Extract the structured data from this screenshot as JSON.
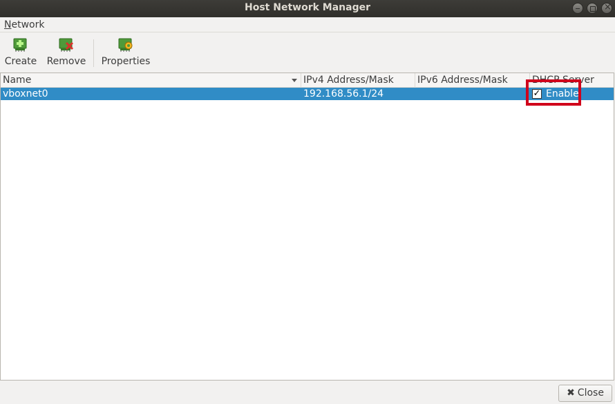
{
  "window": {
    "title": "Host Network Manager"
  },
  "menubar": {
    "items": [
      {
        "label": "Network"
      }
    ]
  },
  "toolbar": {
    "buttons": [
      {
        "label": "Create",
        "icon": "create-network-icon"
      },
      {
        "label": "Remove",
        "icon": "remove-network-icon"
      },
      {
        "label": "Properties",
        "icon": "properties-network-icon"
      }
    ]
  },
  "table": {
    "columns": [
      "Name",
      "IPv4 Address/Mask",
      "IPv6 Address/Mask",
      "DHCP Server"
    ],
    "rows": [
      {
        "name": "vboxnet0",
        "ipv4": "192.168.56.1/24",
        "ipv6": "",
        "dhcp_checked": true,
        "dhcp_label": "Enable"
      }
    ]
  },
  "footer": {
    "close_label": "Close"
  },
  "colors": {
    "selection": "#308cc6",
    "highlight_box": "#d0021b",
    "titlebar": "#3d3c38"
  }
}
